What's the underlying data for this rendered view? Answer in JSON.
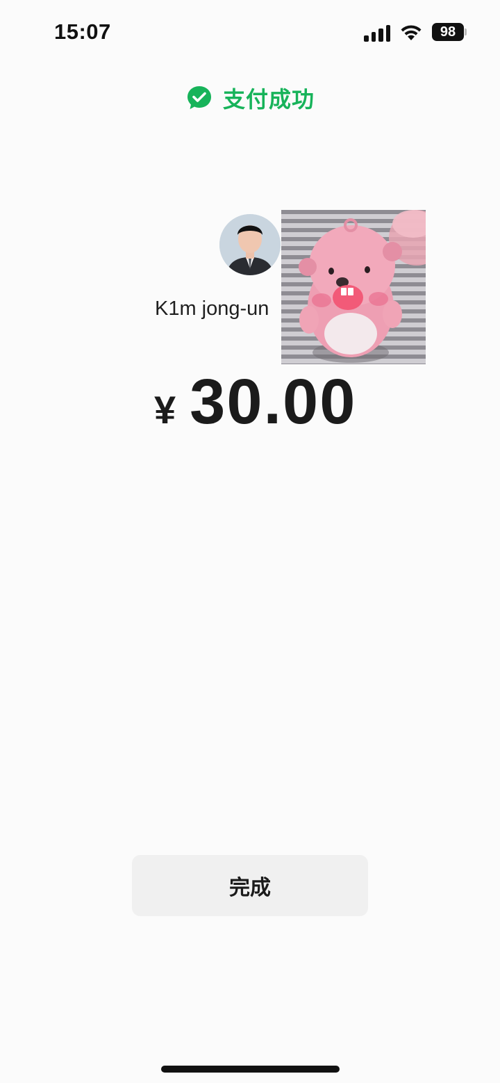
{
  "status_bar": {
    "time": "15:07",
    "battery": "98",
    "icons": [
      "signal-icon",
      "wifi-icon",
      "battery-icon"
    ]
  },
  "header": {
    "title": "支付成功",
    "title_color": "#17b35a",
    "icon": "check-circle-icon"
  },
  "payee": {
    "name": "K1m jong-un",
    "avatar": "avatar",
    "sticker": "pink-beaver-sticker"
  },
  "payment": {
    "currency_symbol": "¥",
    "amount": "30.00"
  },
  "actions": {
    "done_label": "完成"
  }
}
